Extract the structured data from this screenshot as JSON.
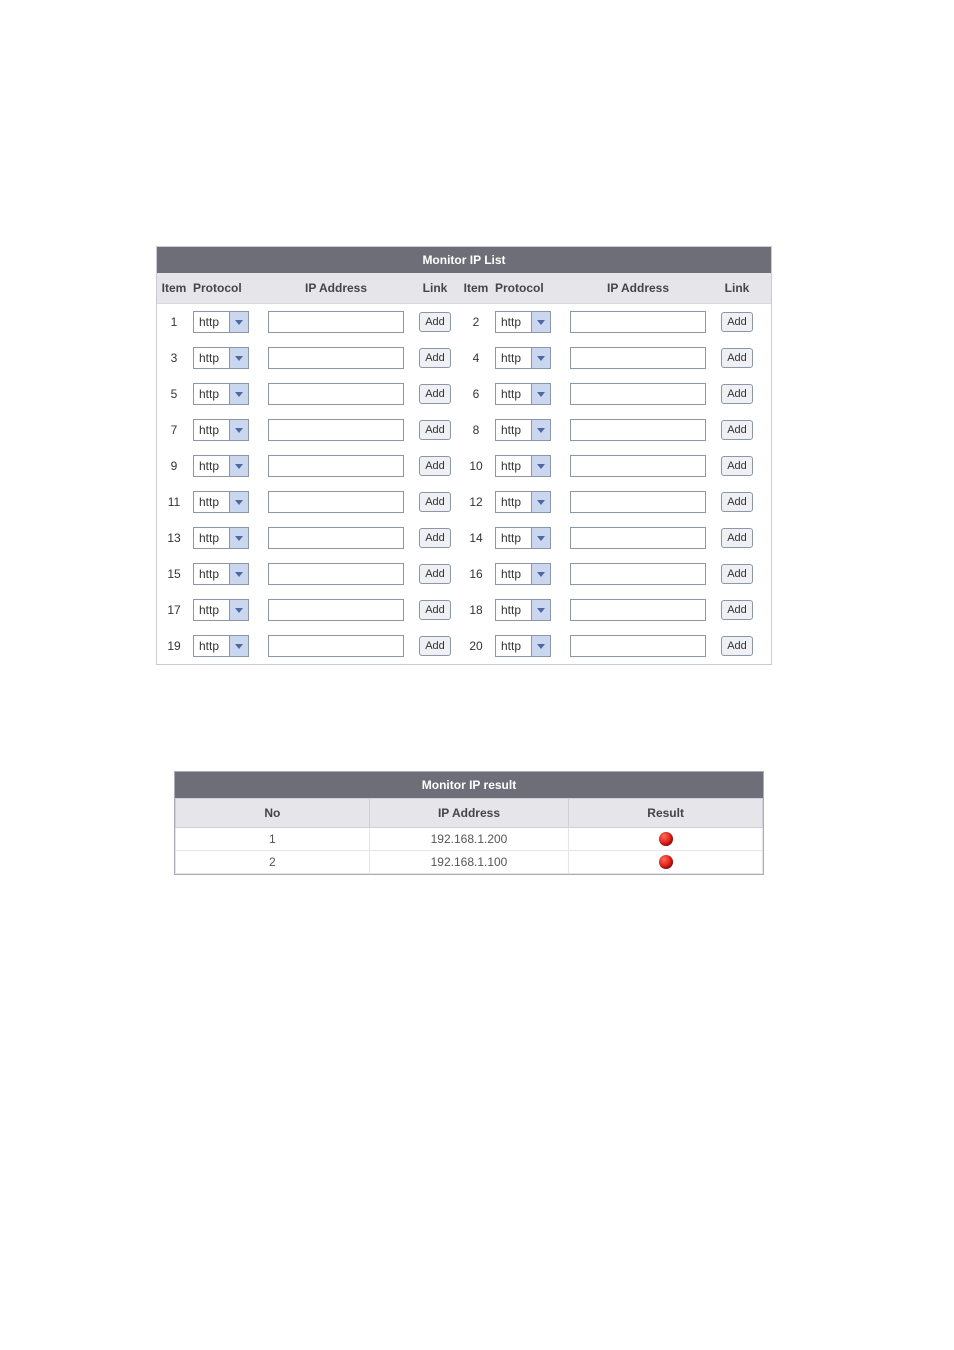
{
  "list": {
    "title": "Monitor IP List",
    "headers": {
      "item": "Item",
      "protocol": "Protocol",
      "ip": "IP Address",
      "link": "Link"
    },
    "add_label": "Add",
    "rows": [
      {
        "item": 1,
        "protocol": "http",
        "ip": ""
      },
      {
        "item": 2,
        "protocol": "http",
        "ip": ""
      },
      {
        "item": 3,
        "protocol": "http",
        "ip": ""
      },
      {
        "item": 4,
        "protocol": "http",
        "ip": ""
      },
      {
        "item": 5,
        "protocol": "http",
        "ip": ""
      },
      {
        "item": 6,
        "protocol": "http",
        "ip": ""
      },
      {
        "item": 7,
        "protocol": "http",
        "ip": ""
      },
      {
        "item": 8,
        "protocol": "http",
        "ip": ""
      },
      {
        "item": 9,
        "protocol": "http",
        "ip": ""
      },
      {
        "item": 10,
        "protocol": "http",
        "ip": ""
      },
      {
        "item": 11,
        "protocol": "http",
        "ip": ""
      },
      {
        "item": 12,
        "protocol": "http",
        "ip": ""
      },
      {
        "item": 13,
        "protocol": "http",
        "ip": ""
      },
      {
        "item": 14,
        "protocol": "http",
        "ip": ""
      },
      {
        "item": 15,
        "protocol": "http",
        "ip": ""
      },
      {
        "item": 16,
        "protocol": "http",
        "ip": ""
      },
      {
        "item": 17,
        "protocol": "http",
        "ip": ""
      },
      {
        "item": 18,
        "protocol": "http",
        "ip": ""
      },
      {
        "item": 19,
        "protocol": "http",
        "ip": ""
      },
      {
        "item": 20,
        "protocol": "http",
        "ip": ""
      }
    ]
  },
  "result": {
    "title": "Monitor IP result",
    "headers": {
      "no": "No",
      "ip": "IP Address",
      "result": "Result"
    },
    "rows": [
      {
        "no": 1,
        "ip": "192.168.1.200",
        "status": "red"
      },
      {
        "no": 2,
        "ip": "192.168.1.100",
        "status": "red"
      }
    ]
  },
  "colors": {
    "header_bg": "#6e6e78",
    "subheader_bg": "#e5e5ea",
    "status_red": "#de1a13"
  }
}
